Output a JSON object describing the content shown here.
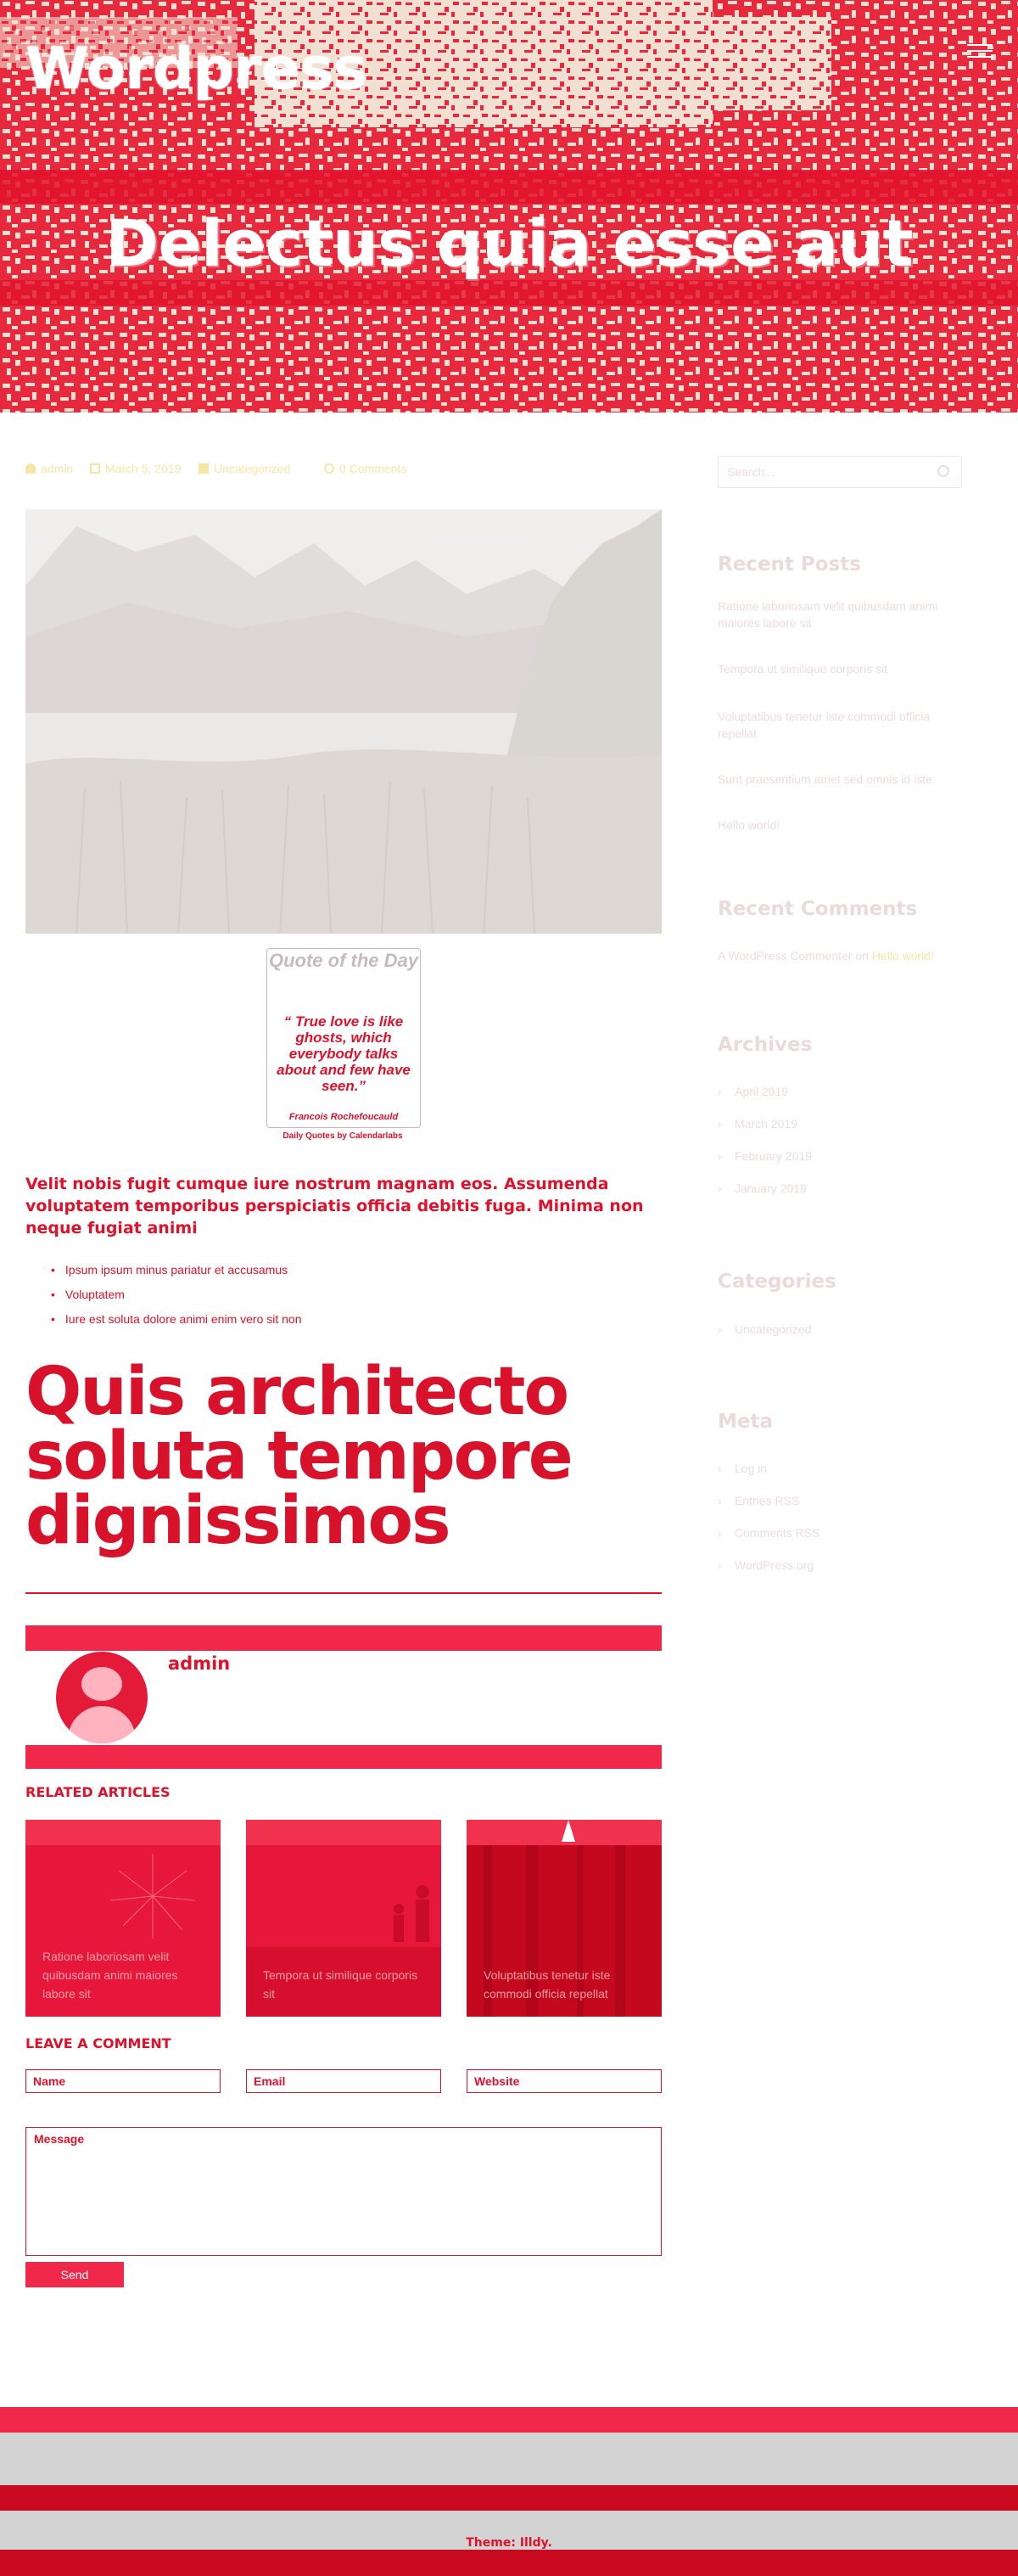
{
  "site": {
    "title": "Wordpress"
  },
  "post": {
    "title": "Delectus quia esse aut",
    "meta": {
      "author": "admin",
      "date": "March 5, 2019",
      "category": "Uncategorized",
      "comments": "0 Comments"
    },
    "quote_widget": {
      "heading": "Quote of the Day",
      "text": "“ True love is like ghosts, which everybody talks about and few have seen.”",
      "author": "Francois Rochefoucauld",
      "credit": "Daily Quotes by Calendarlabs"
    },
    "paragraph": "Velit nobis fugit cumque iure nostrum magnam eos. Assumenda voluptatem temporibus perspiciatis officia debitis fuga. Minima non neque fugiat animi",
    "list_items": [
      "Ipsum ipsum minus pariatur et accusamus",
      "Voluptatem",
      "Iure est soluta dolore animi enim vero sit non"
    ],
    "big_heading": "Quis architecto soluta tempore dignissimos"
  },
  "author_box": {
    "name": "admin"
  },
  "related": {
    "label": "RELATED ARTICLES",
    "items": [
      {
        "title": "Ratione laboriosam velit quibusdam animi maiores labore sit"
      },
      {
        "title": "Tempora ut similique corporis sit"
      },
      {
        "title": "Voluptatibus tenetur iste commodi officia repellat"
      }
    ]
  },
  "comment_form": {
    "label": "LEAVE A COMMENT",
    "name_placeholder": "Name",
    "email_placeholder": "Email",
    "website_placeholder": "Website",
    "message_placeholder": "Message",
    "send_label": "Send"
  },
  "sidebar": {
    "search_placeholder": "Search...",
    "recent_posts": {
      "heading": "Recent Posts",
      "items": [
        "Ratione laboriosam velit quibusdam animi maiores labore sit",
        "Tempora ut similique corporis sit",
        "Voluptatibus tenetur iste commodi officia repellat",
        "Sunt praesentium amet sed omnis id iste",
        "Hello world!"
      ]
    },
    "recent_comments": {
      "heading": "Recent Comments",
      "commenter": "A WordPress Commenter",
      "on_word": "on",
      "post": "Hello world!"
    },
    "archives": {
      "heading": "Archives",
      "items": [
        "April 2019",
        "March 2019",
        "February 2019",
        "January 2019"
      ]
    },
    "categories": {
      "heading": "Categories",
      "items": [
        "Uncategorized"
      ]
    },
    "meta": {
      "heading": "Meta",
      "items": [
        "Log in",
        "Entries RSS",
        "Comments RSS",
        "WordPress.org"
      ]
    }
  },
  "footer": {
    "theme_credit": "Theme: Illdy."
  },
  "colors": {
    "accent_red": "#e0112b",
    "bar_red": "#f2284a",
    "hero_bg": "#efe0cf",
    "meta_yellow": "#f4e7a6",
    "footer_gray": "#d3d3d3"
  }
}
